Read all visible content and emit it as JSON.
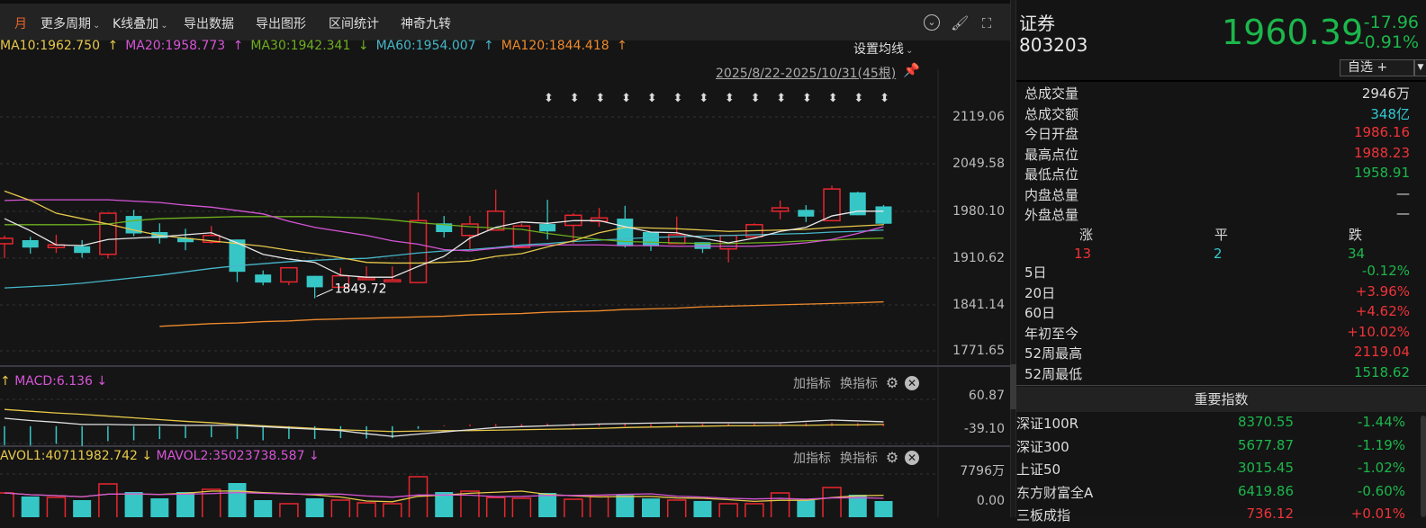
{
  "toolbar": {
    "period": "月",
    "items": [
      "更多周期",
      "K线叠加",
      "导出数据",
      "导出图形",
      "区间统计",
      "神奇九转"
    ]
  },
  "legend": [
    {
      "text": "MA10:1962.750",
      "arrow": "↑",
      "color": "#e7c84a",
      "arrowColor": "#e7c84a"
    },
    {
      "text": "MA20:1958.773",
      "arrow": "↑",
      "color": "#d655d6",
      "arrowColor": "#d655d6"
    },
    {
      "text": "MA30:1942.341",
      "arrow": "↓",
      "color": "#6fae1f",
      "arrowColor": "#6fae1f"
    },
    {
      "text": "MA60:1954.007",
      "arrow": "↑",
      "color": "#46b6c8",
      "arrowColor": "#46b6c8"
    },
    {
      "text": "MA120:1844.418",
      "arrow": "↑",
      "color": "#ee8a2c",
      "arrowColor": "#ee8a2c"
    }
  ],
  "set_ma": "设置均线",
  "date_range": "2025/8/22-2025/10/31(45根)",
  "price_axis": [
    "2119.06",
    "2049.58",
    "1980.10",
    "1910.62",
    "1841.14",
    "1771.65"
  ],
  "low_marker": "1849.72",
  "macd": {
    "label": "MACD:6.136",
    "pre_arrow": "↑",
    "arrow": "↓",
    "axis": [
      "60.87",
      "-39.10"
    ],
    "add": "加指标",
    "swap": "换指标"
  },
  "vol": {
    "label1": "AVOL1:40711982.742",
    "arrow1": "↓",
    "label2": "MAVOL2:35023738.587",
    "arrow2": "↓",
    "axis": [
      "7796万",
      "0.00"
    ],
    "add": "加指标",
    "swap": "换指标"
  },
  "colors": {
    "up": "#e8262e",
    "down": "#37c6c6",
    "ma5": "#e8e8e8",
    "ma10": "#e7c84a",
    "ma20": "#d655d6",
    "ma30": "#6fae1f",
    "ma60": "#46b6c8",
    "ma120": "#ee8a2c"
  },
  "chart_data": {
    "type": "candlestick",
    "ylim": [
      1771.65,
      2119.06
    ],
    "candles": [
      [
        1930.7,
        1938.7,
        1942.7,
        1909.3
      ],
      [
        1936,
        1925,
        1941,
        1916
      ],
      [
        1925,
        1929,
        1944,
        1917
      ],
      [
        1927,
        1917,
        1936,
        1910
      ],
      [
        1915,
        1976,
        1976,
        1909
      ],
      [
        1972,
        1946,
        1981,
        1942
      ],
      [
        1948,
        1939,
        1961,
        1931
      ],
      [
        1939,
        1933,
        1953,
        1921
      ],
      [
        1933,
        1943,
        1957,
        1931
      ],
      [
        1937,
        1889,
        1937,
        1874
      ],
      [
        1885,
        1873,
        1891,
        1869
      ],
      [
        1874,
        1895,
        1895,
        1869
      ],
      [
        1883,
        1866,
        1883,
        1849.72
      ],
      [
        1866,
        1883,
        1895,
        1866
      ],
      [
        1879,
        1880,
        1897,
        1878
      ],
      [
        1875,
        1877,
        1897,
        1874
      ],
      [
        1873,
        1965,
        2007,
        1873
      ],
      [
        1961,
        1948,
        1972,
        1940
      ],
      [
        1943,
        1960,
        1972,
        1923
      ],
      [
        1951,
        1979,
        2011,
        1951
      ],
      [
        1925,
        1957,
        1961,
        1925
      ],
      [
        1960,
        1949,
        1996,
        1937
      ],
      [
        1958,
        1973,
        1976,
        1931
      ],
      [
        1964,
        1969,
        1984,
        1956
      ],
      [
        1968,
        1927,
        1987,
        1925
      ],
      [
        1948,
        1927,
        1948,
        1920
      ],
      [
        1931,
        1944,
        1971,
        1931
      ],
      [
        1933,
        1923,
        1933,
        1917
      ],
      [
        1923,
        1943,
        1943,
        1903
      ],
      [
        1941,
        1959,
        1961,
        1941
      ],
      [
        1979,
        1984,
        1995,
        1967
      ],
      [
        1981,
        1971,
        1988,
        1963
      ],
      [
        1965,
        2012,
        2017,
        1965
      ],
      [
        2007,
        1973,
        2008,
        1973
      ],
      [
        1986.16,
        1960.39,
        1988.23,
        1958.91
      ]
    ],
    "ma5": [
      1968,
      1950,
      1929,
      1928,
      1937,
      1939,
      1941,
      1944,
      1947,
      1932,
      1915,
      1908,
      1903,
      1884,
      1881,
      1881,
      1897,
      1912,
      1939,
      1955,
      1963,
      1961,
      1965,
      1965,
      1956,
      1948,
      1947,
      1939,
      1932,
      1939,
      1949,
      1955,
      1972,
      1979,
      1979
    ],
    "ma10": [
      2009,
      1995,
      1976,
      1968,
      1960,
      1951,
      1943,
      1939,
      1935,
      1931,
      1927,
      1921,
      1916,
      1910,
      1903,
      1902,
      1902,
      1903,
      1905,
      1912,
      1916,
      1926,
      1935,
      1947,
      1955,
      1954,
      1953,
      1951,
      1949,
      1950,
      1951,
      1952,
      1955,
      1957,
      1959
    ],
    "ma20": [
      1995,
      1996,
      1996,
      1996,
      1996,
      1994,
      1992,
      1988,
      1985,
      1980,
      1975,
      1964,
      1955,
      1949,
      1943,
      1935,
      1930,
      1922,
      1920,
      1924,
      1927,
      1929,
      1929,
      1929,
      1928,
      1928,
      1927,
      1927,
      1927,
      1927,
      1929,
      1932,
      1937,
      1946,
      1956
    ],
    "ma30": [
      1959,
      1959,
      1959,
      1959,
      1960,
      1965,
      1968,
      1969,
      1970,
      1971,
      1971,
      1971,
      1971,
      1970,
      1969,
      1966,
      1962,
      1959,
      1956,
      1954,
      1952,
      1946,
      1941,
      1937,
      1934,
      1933,
      1932,
      1931,
      1931,
      1932,
      1933,
      1935,
      1936,
      1938,
      1939
    ],
    "ma60": [
      1865,
      1867,
      1869,
      1872,
      1876,
      1880,
      1884,
      1889,
      1894,
      1898,
      1901,
      1904,
      1906,
      1908,
      1909,
      1913,
      1917,
      1920,
      1922,
      1925,
      1929,
      1931,
      1934,
      1936,
      1938,
      1940,
      1941,
      1942,
      1943,
      1944,
      1945,
      1946,
      1948,
      1949,
      1951
    ],
    "ma120": [
      null,
      null,
      null,
      null,
      null,
      null,
      1808,
      1810,
      1812,
      1813,
      1815,
      1816,
      1818,
      1819,
      1820,
      1821,
      1822,
      1823,
      1825,
      1826,
      1827,
      1829,
      1830,
      1831,
      1833,
      1834,
      1835,
      1837,
      1838,
      1839,
      1840,
      1841,
      1842,
      1843,
      1844.4
    ],
    "macd_ylim": [
      -39.1,
      60.87
    ],
    "dif": [
      18,
      13,
      9,
      4,
      4,
      3,
      3,
      2,
      2,
      2,
      -1,
      -4,
      -7,
      -10,
      -17,
      -23,
      -18,
      -13,
      -8,
      -3,
      -1,
      1,
      3,
      5,
      6,
      7,
      8,
      8,
      8,
      8,
      8,
      11,
      14,
      12,
      10
    ],
    "dea": [
      38,
      34,
      30,
      27,
      23,
      19,
      15,
      11,
      8,
      4,
      1,
      -2,
      -5,
      -8,
      -10,
      -12,
      -11,
      -10,
      -10,
      -9,
      -8,
      -7,
      -6,
      -5,
      -3,
      -2,
      -1,
      0,
      1,
      1,
      2,
      2,
      3,
      3,
      4
    ],
    "hist": [
      -43,
      -44,
      -40,
      -45,
      -34,
      -32,
      -29,
      -27,
      -25,
      -29,
      -32,
      -29,
      -29,
      -27,
      -28,
      -27,
      -6,
      2,
      4,
      5,
      5,
      6,
      6,
      6,
      6,
      5,
      5,
      6,
      6,
      6,
      7,
      7,
      8,
      7,
      6
    ],
    "volume_wan": [
      5553,
      5126,
      5019,
      4699,
      6621,
      5660,
      4913,
      5660,
      5980,
      6728,
      4699,
      4272,
      4913,
      4699,
      4379,
      4272,
      7476,
      5660,
      5766,
      5000,
      4913,
      5553,
      4800,
      5100,
      5300,
      4900,
      4700,
      4600,
      4272,
      4272,
      5553,
      4699,
      6198,
      5340,
      4592
    ]
  },
  "quote": {
    "name": "证券",
    "code": "803203",
    "price": "1960.39",
    "change": "-17.96",
    "change_pct": "-0.91%",
    "watch": "自选 +"
  },
  "stats": [
    {
      "label": "总成交量",
      "value": "2946万",
      "color": "white"
    },
    {
      "label": "总成交额",
      "value": "348亿",
      "color": "cyan"
    },
    {
      "label": "今日开盘",
      "value": "1986.16",
      "color": "red"
    },
    {
      "label": "最高点位",
      "value": "1988.23",
      "color": "red"
    },
    {
      "label": "最低点位",
      "value": "1958.91",
      "color": "green"
    },
    {
      "label": "内盘总量",
      "value": "—",
      "color": "white"
    },
    {
      "label": "外盘总量",
      "value": "—",
      "color": "white"
    }
  ],
  "breadth": {
    "up_label": "涨",
    "flat_label": "平",
    "down_label": "跌",
    "up": "13",
    "flat": "2",
    "down": "34"
  },
  "perf": [
    {
      "label": "5日",
      "value": "-0.12%",
      "color": "green"
    },
    {
      "label": "20日",
      "value": "+3.96%",
      "color": "red"
    },
    {
      "label": "60日",
      "value": "+4.62%",
      "color": "red"
    },
    {
      "label": "年初至今",
      "value": "+10.02%",
      "color": "red"
    },
    {
      "label": "52周最高",
      "value": "2119.04",
      "color": "red"
    },
    {
      "label": "52周最低",
      "value": "1518.62",
      "color": "green"
    }
  ],
  "indices_title": "重要指数",
  "indices": [
    {
      "name": "深证100R",
      "price": "8370.55",
      "chg": "-1.44%",
      "color": "green"
    },
    {
      "name": "深证300",
      "price": "5677.87",
      "chg": "-1.19%",
      "color": "green"
    },
    {
      "name": "上证50",
      "price": "3015.45",
      "chg": "-1.02%",
      "color": "green"
    },
    {
      "name": "东方财富全A",
      "price": "6419.86",
      "chg": "-0.60%",
      "color": "green"
    },
    {
      "name": "三板成指",
      "price": "736.12",
      "chg": "+0.01%",
      "color": "red"
    }
  ]
}
